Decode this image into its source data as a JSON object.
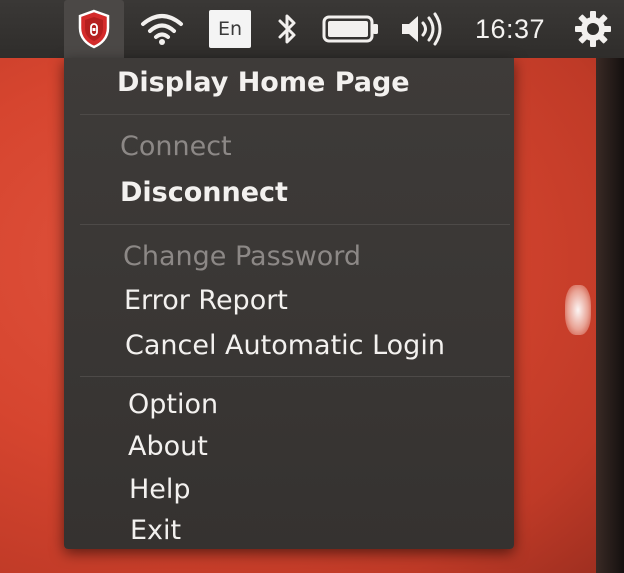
{
  "panel": {
    "keyboard_layout": "En",
    "clock": "16:37",
    "icons": [
      "shield-app-icon",
      "wifi-icon",
      "bluetooth-icon",
      "battery-icon",
      "volume-icon",
      "gear-icon"
    ]
  },
  "menu": {
    "items": [
      {
        "label": "Display Home Page",
        "enabled": true
      },
      {
        "label": "Connect",
        "enabled": false
      },
      {
        "label": "Disconnect",
        "enabled": true
      },
      {
        "label": "Change Password",
        "enabled": false
      },
      {
        "label": "Error Report",
        "enabled": true
      },
      {
        "label": "Cancel Automatic Login",
        "enabled": true
      },
      {
        "label": "Option",
        "enabled": true
      },
      {
        "label": "About",
        "enabled": true
      },
      {
        "label": "Help",
        "enabled": true
      },
      {
        "label": "Exit",
        "enabled": true
      }
    ]
  },
  "colors": {
    "panel": "#2f2d2b",
    "menu_background": "#3a3735",
    "menu_text": "#f3f1ef",
    "menu_text_disabled": "#8c8886",
    "wallpaper": "#d6452f",
    "shield_red": "#d42b2b"
  }
}
